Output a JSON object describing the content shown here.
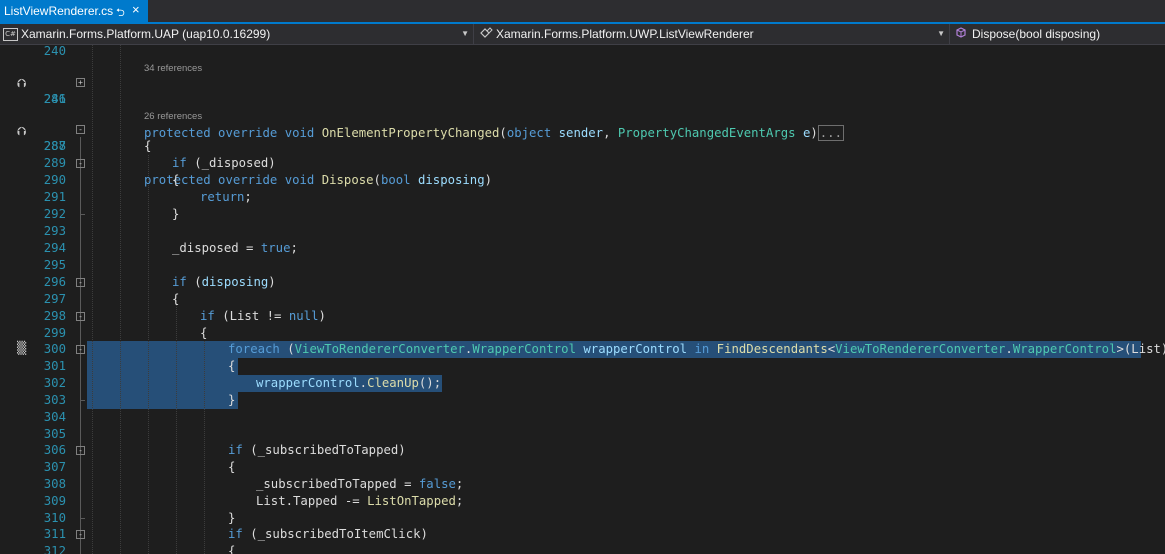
{
  "tab": {
    "title": "ListViewRenderer.cs",
    "pin": "⮌",
    "close": "×"
  },
  "nav": {
    "project": "Xamarin.Forms.Platform.UAP (uap10.0.16299)",
    "type": "Xamarin.Forms.Platform.UWP.ListViewRenderer",
    "member": "Dispose(bool disposing)",
    "project_icon": "C#",
    "dropdown_arrow": "▼"
  },
  "refs": {
    "r1": "34 references",
    "r2": "26 references"
  },
  "lines": {
    "n240": "240",
    "n241": "241",
    "n286": "286",
    "n287": "287",
    "n288": "288",
    "n289": "289",
    "n290": "290",
    "n291": "291",
    "n292": "292",
    "n293": "293",
    "n294": "294",
    "n295": "295",
    "n296": "296",
    "n297": "297",
    "n298": "298",
    "n299": "299",
    "n300": "300",
    "n301": "301",
    "n302": "302",
    "n303": "303",
    "n304": "304",
    "n305": "305",
    "n306": "306",
    "n307": "307",
    "n308": "308",
    "n309": "309",
    "n310": "310",
    "n311": "311",
    "n312": "312"
  },
  "tok": {
    "protected": "protected",
    "override": "override",
    "void": "void",
    "onElementPropertyChanged": "OnElementPropertyChanged",
    "object": "object",
    "sender": "sender",
    "propertyChangedEventArgs": "PropertyChangedEventArgs",
    "e": "e",
    "ellipsis": "...",
    "dispose": "Dispose",
    "bool": "bool",
    "disposing": "disposing",
    "lbrace": "{",
    "rbrace": "}",
    "if": "if",
    "disposedField": "_disposed",
    "return": "return",
    "true": "true",
    "false": "false",
    "list": "List",
    "null": "null",
    "foreach": "foreach",
    "vtrc": "ViewToRendererConverter",
    "dot": ".",
    "wrapperControlType": "WrapperControl",
    "wrapperControl": "wrapperControl",
    "in": "in",
    "findDescendants": "FindDescendants",
    "cleanUp": "CleanUp",
    "subscribedToTapped": "_subscribedToTapped",
    "tapped": "Tapped",
    "listOnTapped": "ListOnTapped",
    "subscribedToItemClick": "_subscribedToItemClick",
    "lp": "(",
    "rp": ")",
    "lt": "<",
    "gt": ">",
    "semi": ";",
    "eq": " = ",
    "minusEq": " -= ",
    "neq": " != ",
    "sp": " ",
    "comma": ", ",
    "callEnd": "();"
  },
  "colors": {
    "accent": "#007acc",
    "selection": "#264f78",
    "keyword": "#569cd6",
    "type": "#4ec9b0",
    "method": "#dcdcaa",
    "parameter": "#9cdcfe",
    "line_number": "#2b91af"
  }
}
